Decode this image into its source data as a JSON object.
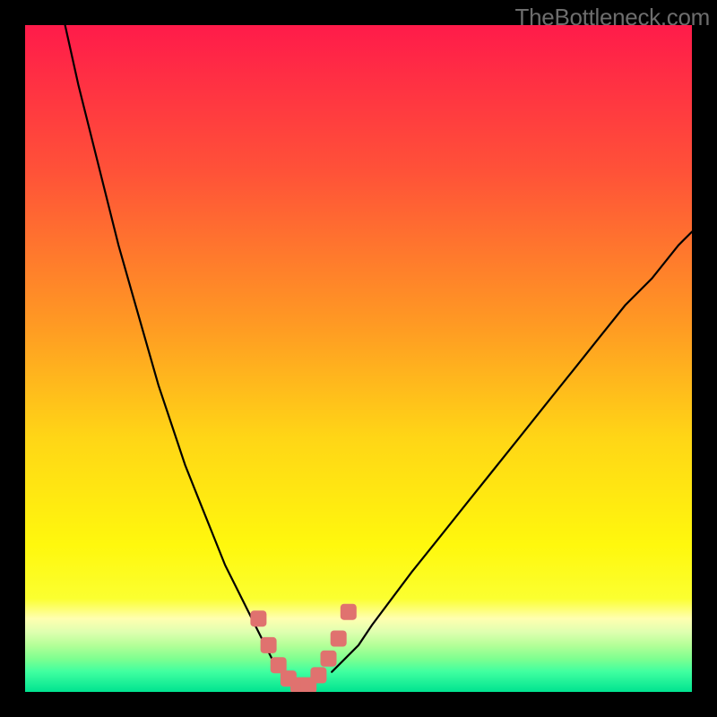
{
  "attribution": "TheBottleneck.com",
  "chart_data": {
    "type": "line",
    "title": "",
    "xlabel": "",
    "ylabel": "",
    "xlim": [
      0,
      100
    ],
    "ylim": [
      0,
      100
    ],
    "grid": false,
    "legend": false,
    "series": [
      {
        "name": "left-curve",
        "x": [
          6,
          8,
          10,
          12,
          14,
          16,
          18,
          20,
          22,
          24,
          26,
          28,
          30,
          32,
          34,
          36,
          37,
          38
        ],
        "y": [
          100,
          91,
          83,
          75,
          67,
          60,
          53,
          46,
          40,
          34,
          29,
          24,
          19,
          15,
          11,
          7,
          5,
          3
        ]
      },
      {
        "name": "right-curve",
        "x": [
          46,
          48,
          50,
          52,
          55,
          58,
          62,
          66,
          70,
          74,
          78,
          82,
          86,
          90,
          94,
          98,
          100
        ],
        "y": [
          3,
          5,
          7,
          10,
          14,
          18,
          23,
          28,
          33,
          38,
          43,
          48,
          53,
          58,
          62,
          67,
          69
        ]
      },
      {
        "name": "valley-markers",
        "type": "scatter",
        "x": [
          35,
          36.5,
          38,
          39.5,
          41,
          42.5,
          44,
          45.5,
          47,
          48.5
        ],
        "y": [
          11,
          7,
          4,
          2,
          1,
          1,
          2.5,
          5,
          8,
          12
        ],
        "marker": "square",
        "marker_color": "#e0726f",
        "marker_size": 18
      }
    ],
    "background_gradient": {
      "type": "vertical",
      "stops": [
        {
          "pos": 0.0,
          "color": "#ff1b4a"
        },
        {
          "pos": 0.22,
          "color": "#ff5238"
        },
        {
          "pos": 0.45,
          "color": "#ff9a23"
        },
        {
          "pos": 0.62,
          "color": "#ffd616"
        },
        {
          "pos": 0.78,
          "color": "#fff80d"
        },
        {
          "pos": 0.86,
          "color": "#fbff30"
        },
        {
          "pos": 0.89,
          "color": "#ffffb0"
        },
        {
          "pos": 0.91,
          "color": "#dfffb0"
        },
        {
          "pos": 0.93,
          "color": "#b4ff98"
        },
        {
          "pos": 0.95,
          "color": "#7fff90"
        },
        {
          "pos": 0.97,
          "color": "#3fffa0"
        },
        {
          "pos": 1.0,
          "color": "#00e390"
        }
      ]
    }
  }
}
